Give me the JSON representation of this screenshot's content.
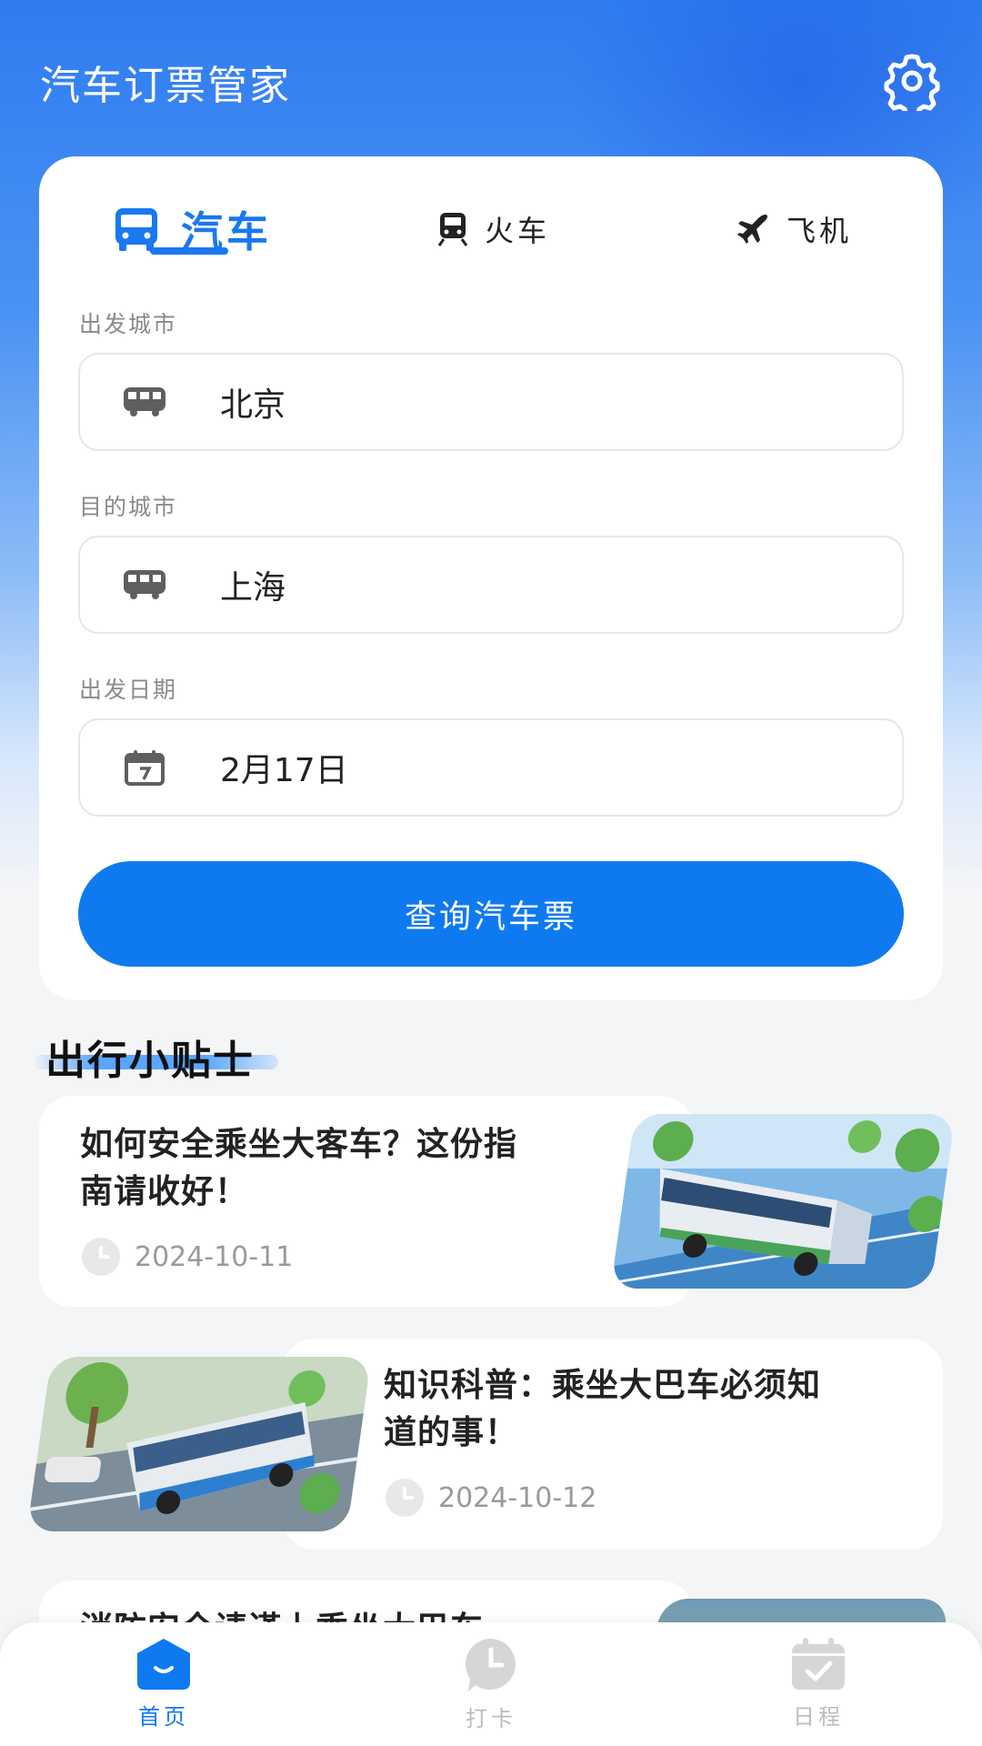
{
  "app": {
    "title": "汽车订票管家"
  },
  "colors": {
    "accent": "#0f7af0",
    "inactive_icon": "#d6d6d6",
    "label_gray": "#8a8a8a"
  },
  "tabs": [
    {
      "label": "汽车",
      "icon": "bus-icon",
      "active": true
    },
    {
      "label": "火车",
      "icon": "train-icon",
      "active": false
    },
    {
      "label": "飞机",
      "icon": "plane-icon",
      "active": false
    }
  ],
  "form": {
    "departure": {
      "label": "出发城市",
      "value": "北京",
      "icon": "bus-icon"
    },
    "destination": {
      "label": "目的城市",
      "value": "上海",
      "icon": "bus-icon"
    },
    "date": {
      "label": "出发日期",
      "value": "2月17日",
      "icon": "calendar-icon"
    },
    "submit_label": "查询汽车票"
  },
  "tips": {
    "title": "出行小贴士",
    "articles": [
      {
        "title_line1": "如何安全乘坐大客车？这份指",
        "title_line2": "南请收好！",
        "date": "2024-10-11"
      },
      {
        "title_line1": "知识科普：乘坐大巴车必须知",
        "title_line2": "道的事！",
        "date": "2024-10-12"
      },
      {
        "title_line1": "消防安全请谨上乘坐大巴车"
      }
    ]
  },
  "bottom_nav": [
    {
      "label": "首页",
      "icon": "home-icon",
      "active": true
    },
    {
      "label": "打卡",
      "icon": "checkin-clock-icon",
      "active": false
    },
    {
      "label": "日程",
      "icon": "schedule-calendar-icon",
      "active": false
    }
  ]
}
